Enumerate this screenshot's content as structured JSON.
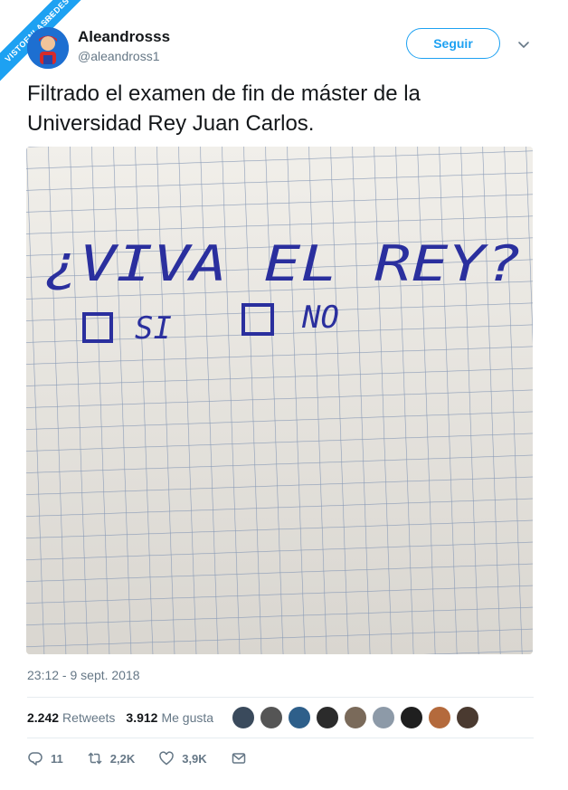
{
  "watermark": {
    "text": "VISTOENLASREDES",
    "suffix": ".com"
  },
  "user": {
    "name": "Aleandrosss",
    "handle": "@aleandross1"
  },
  "follow_label": "Seguir",
  "tweet": {
    "line1": "Filtrado el examen de fin de máster de la",
    "line2": "Universidad Rey Juan Carlos."
  },
  "photo": {
    "question": "¿VIVA EL REY?",
    "option_yes": "SI",
    "option_no": "NO"
  },
  "timestamp": "23:12 - 9 sept. 2018",
  "stats": {
    "retweets_count": "2.242",
    "retweets_label": "Retweets",
    "likes_count": "3.912",
    "likes_label": "Me gusta"
  },
  "actions": {
    "replies": "11",
    "retweets": "2,2K",
    "likes": "3,9K"
  },
  "colors": {
    "accent": "#1da1f2",
    "text_secondary": "#657786",
    "ink": "#2a2f9e"
  },
  "icons": [
    "reply-icon",
    "retweet-icon",
    "like-icon",
    "message-icon",
    "chevron-down-icon"
  ]
}
